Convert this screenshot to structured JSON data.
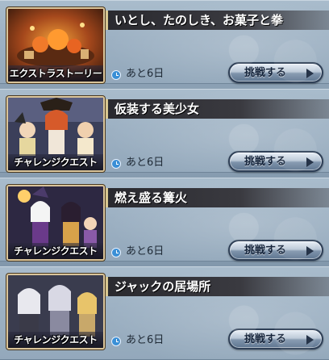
{
  "quests": [
    {
      "category": "エクストラストーリー",
      "title": "いとし、たのしき、お菓子と拳",
      "remaining": "あと6日",
      "button_label": "挑戦する",
      "thumb_colors": [
        "#6b3a1c",
        "#e0742a"
      ]
    },
    {
      "category": "チャレンジクエスト",
      "title": "仮装する美少女",
      "remaining": "あと6日",
      "button_label": "挑戦する",
      "thumb_colors": [
        "#3b3f5a",
        "#d65a2a"
      ]
    },
    {
      "category": "チャレンジクエスト",
      "title": "燃え盛る篝火",
      "remaining": "あと6日",
      "button_label": "挑戦する",
      "thumb_colors": [
        "#2d2842",
        "#8a5aa8"
      ]
    },
    {
      "category": "チャレンジクエスト",
      "title": "ジャックの居場所",
      "remaining": "あと6日",
      "button_label": "挑戦する",
      "thumb_colors": [
        "#3a3c4e",
        "#c8a86a"
      ]
    }
  ]
}
